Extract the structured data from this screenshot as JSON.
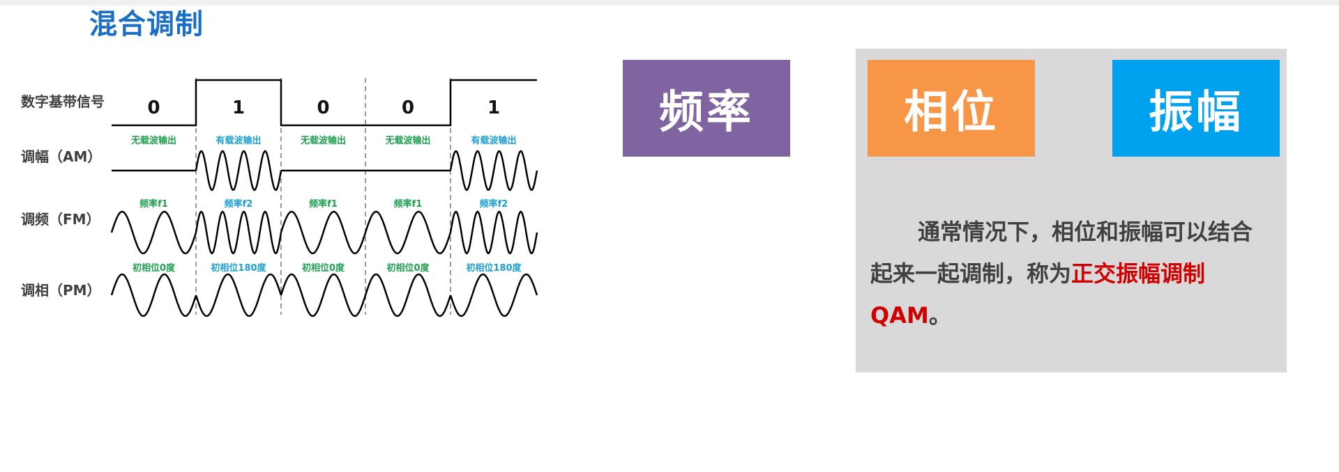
{
  "title": "混合调制",
  "diagram": {
    "rows": [
      {
        "key": "digital",
        "label": "数字基带信号"
      },
      {
        "key": "am",
        "label": "调幅（AM）"
      },
      {
        "key": "fm",
        "label": "调频（FM）"
      },
      {
        "key": "pm",
        "label": "调相（PM）"
      }
    ],
    "bits": [
      "0",
      "1",
      "0",
      "0",
      "1"
    ],
    "am_labels": [
      "无载波输出",
      "有载波输出",
      "无载波输出",
      "无载波输出",
      "有载波输出"
    ],
    "fm_labels": [
      "频率f1",
      "频率f2",
      "频率f1",
      "频率f1",
      "频率f2"
    ],
    "pm_labels": [
      "初相位0度",
      "初相位180度",
      "初相位0度",
      "初相位0度",
      "初相位180度"
    ],
    "colors": {
      "green": "#1fa050",
      "blue": "#1c9fd6",
      "wave": "#000000",
      "divider": "#9a9a9a"
    }
  },
  "boxes": {
    "frequency": "频率",
    "phase": "相位",
    "amplitude": "振幅"
  },
  "description": {
    "part1": "通常情况下，相位和振幅可以结合起来一起调制，称为",
    "highlight": "正交振幅调制QAM",
    "part2": "。"
  }
}
